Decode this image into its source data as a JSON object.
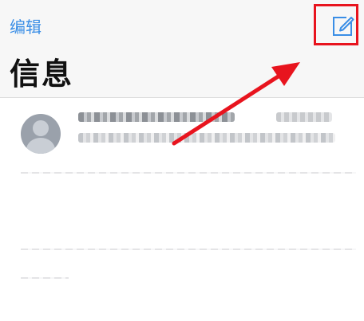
{
  "nav": {
    "edit_label": "编辑",
    "title": "信息",
    "compose_icon": "compose-icon"
  },
  "annotation": {
    "highlight_color": "#e8141e",
    "arrow_color": "#e8141e"
  },
  "colors": {
    "accent": "#3a8ee6",
    "nav_background": "#f7f7f7"
  }
}
